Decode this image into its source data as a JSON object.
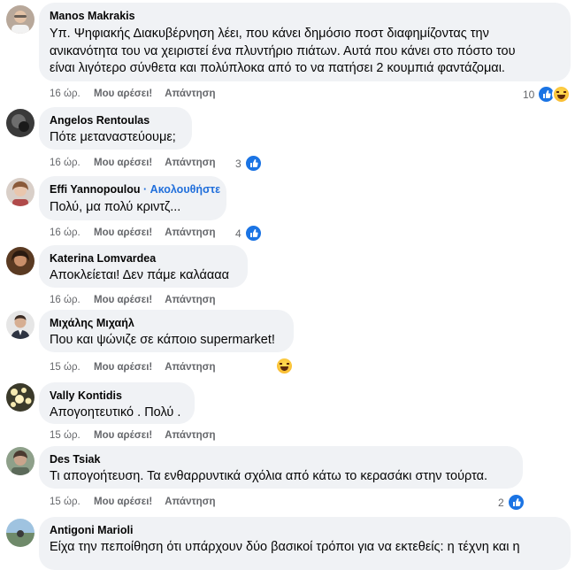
{
  "actions": {
    "like_label": "Μου αρέσει!",
    "reply_label": "Απάντηση"
  },
  "comments": [
    {
      "author": "Manos Makrakis",
      "text_lines": [
        "Υπ. Ψηφιακής Διακυβέρνηση λέει, που κάνει δημόσιο ποστ διαφημίζοντας την",
        "ανικανότητα του να χειριστεί ένα πλυντήριο πιάτων. Αυτά που κάνει στο πόστο του",
        "είναι λιγότερο σύνθετα και πολύπλοκα από το να πατήσει 2 κουμπιά φαντάζομαι."
      ],
      "time": "16 ώρ.",
      "reaction_count": "10",
      "reactions": [
        "like-icon",
        "haha-icon"
      ]
    },
    {
      "author": "Angelos Rentoulas",
      "text_lines": [
        "Πότε μεταναστεύουμε;"
      ],
      "time": "16 ώρ.",
      "reaction_count": "3",
      "reactions": [
        "like-icon"
      ]
    },
    {
      "author": "Effi Yannopoulou",
      "follow_label": "· Ακολουθήστε",
      "text_lines": [
        "Πολύ, μα πολύ κριντζ..."
      ],
      "time": "16 ώρ.",
      "reaction_count": "4",
      "reactions": [
        "like-icon"
      ]
    },
    {
      "author": "Katerina Lomvardea",
      "text_lines": [
        "Αποκλείεται! Δεν πάμε καλάααα"
      ],
      "time": "16 ώρ."
    },
    {
      "author": "Μιχάλης Μιχαήλ",
      "text_lines": [
        "Που και ψώνιζε σε κάποιο supermarket!"
      ],
      "time": "15 ώρ.",
      "reactions": [
        "haha-icon"
      ]
    },
    {
      "author": "Vally Kontidis",
      "text_lines": [
        "Απογοητευτικό . Πολύ ."
      ],
      "time": "15 ώρ."
    },
    {
      "author": "Des Tsiak",
      "text_lines": [
        "Τι απογοήτευση. Τα ενθαρρυντικά σχόλια από κάτω το κερασάκι στην τούρτα."
      ],
      "time": "15 ώρ.",
      "reaction_count": "2",
      "reactions": [
        "like-icon"
      ]
    },
    {
      "author": "Antigoni Marioli",
      "text_lines": [
        "Είχα την πεποίθηση ότι υπάρχουν δύο βασικοί τρόποι για να εκτεθείς: η τέχνη και η"
      ]
    }
  ]
}
